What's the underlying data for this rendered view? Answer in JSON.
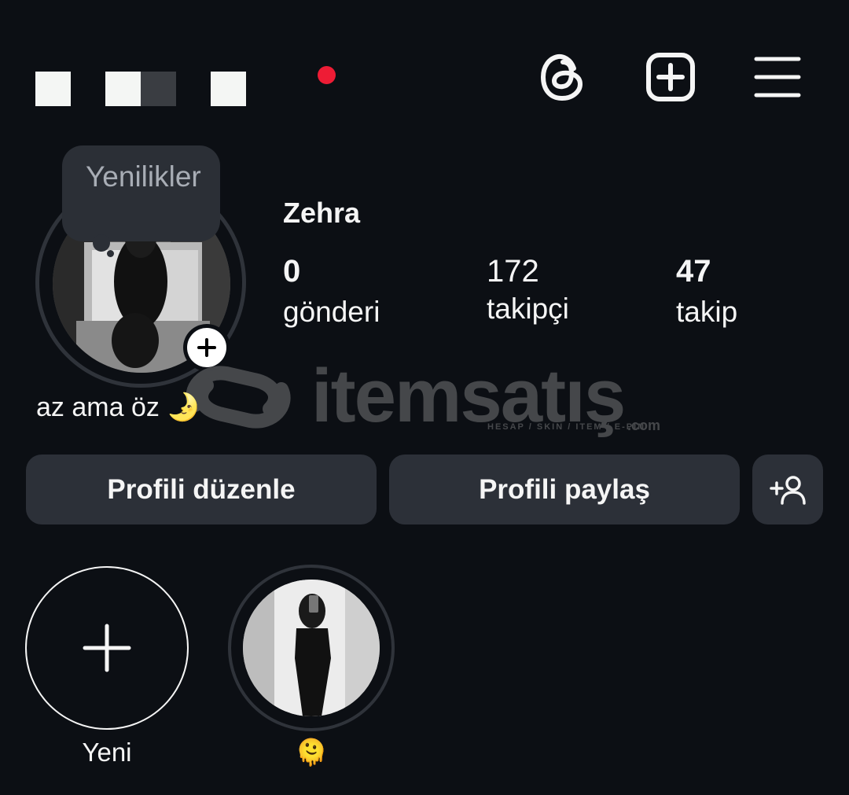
{
  "header": {
    "red_dot_color": "#ee1c35",
    "icons": [
      "threads-icon",
      "add-post-icon",
      "menu-icon"
    ]
  },
  "profile": {
    "tooltip": "Yenilikler",
    "username": "Zehra",
    "stats": [
      {
        "value": "0",
        "label": "gönderi"
      },
      {
        "value": "172",
        "label": "takipçi"
      },
      {
        "value": "47",
        "label": "takip"
      }
    ],
    "bio": "az ama öz 🌛"
  },
  "actions": {
    "edit_profile": "Profili düzenle",
    "share_profile": "Profili paylaş"
  },
  "highlights": {
    "new_label": "Yeni",
    "items": [
      {
        "label": "🫠"
      }
    ]
  },
  "watermark": {
    "brand": "itemsatış",
    "tagline": "HESAP / SKIN / ITEM / E-PIN",
    "suffix": ".com"
  }
}
